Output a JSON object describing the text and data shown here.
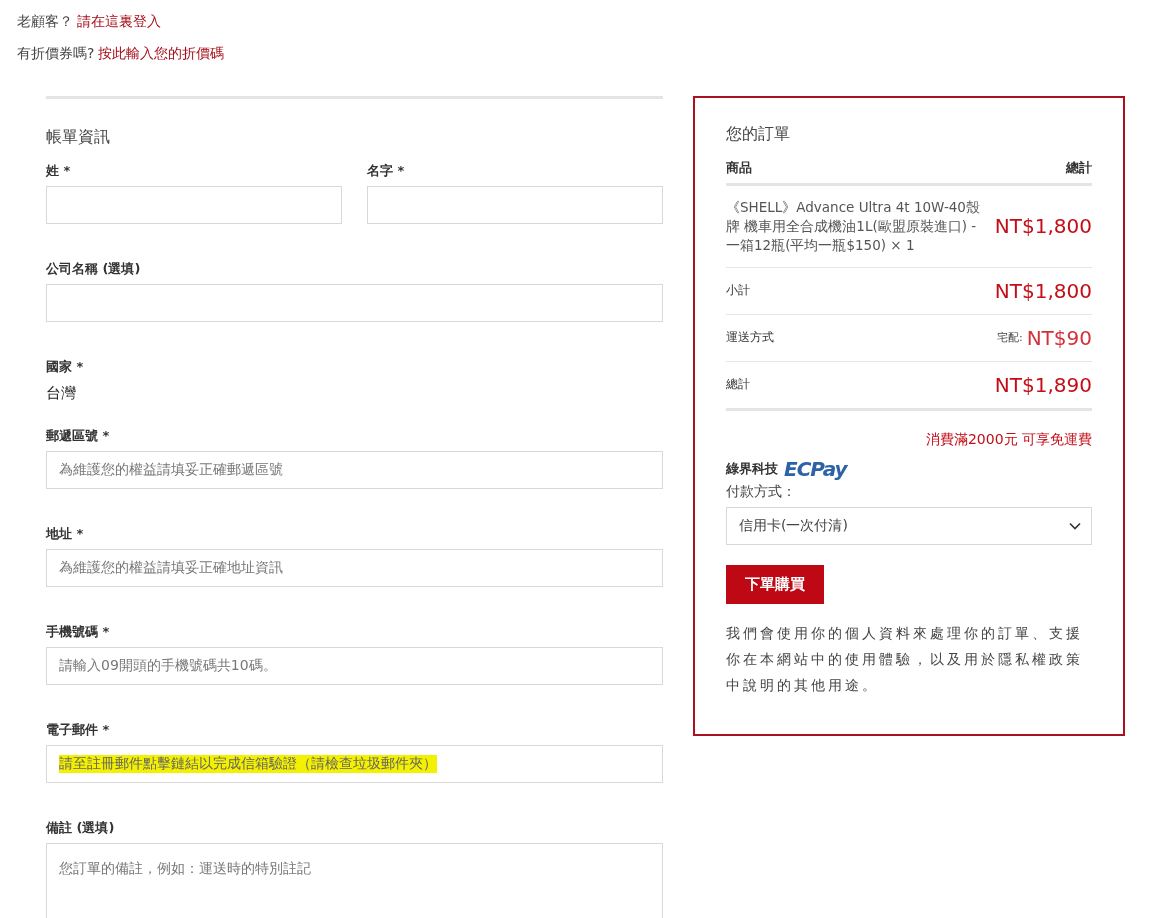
{
  "notices": [
    {
      "text": "老顧客？",
      "link": "請在這裏登入"
    },
    {
      "text": "有折價券嗎?",
      "link": "按此輸入您的折價碼"
    }
  ],
  "billing": {
    "title": "帳單資訊",
    "fields": [
      {
        "kind": "input",
        "label": "姓 *",
        "half": true
      },
      {
        "kind": "input",
        "label": "名字 *",
        "half": true
      },
      {
        "kind": "input",
        "label": "公司名稱 (選填)",
        "half": false
      },
      {
        "kind": "static",
        "label": "國家 *",
        "value": "台灣",
        "half": false
      },
      {
        "kind": "input",
        "label": "郵遞區號 *",
        "placeholder": "為維護您的權益請填妥正確郵遞區號",
        "half": false
      },
      {
        "kind": "input",
        "label": "地址 *",
        "placeholder": "為維護您的權益請填妥正確地址資訊",
        "half": false
      },
      {
        "kind": "input",
        "label": "手機號碼 *",
        "placeholder": "請輸入09開頭的手機號碼共10碼。",
        "half": false
      },
      {
        "kind": "input",
        "label": "電子郵件 *",
        "placeholder": "請至註冊郵件點擊鏈結以完成信箱驗證（請檢查垃圾郵件夾）",
        "highlighted": true,
        "half": false
      },
      {
        "kind": "textarea",
        "label": "備註 (選填)",
        "placeholder": "您訂單的備註，例如：運送時的特別註記",
        "half": false
      }
    ]
  },
  "order": {
    "title": "您的訂單",
    "columns": [
      "商品",
      "總計"
    ],
    "items": [
      {
        "name": "《SHELL》Advance Ultra 4t 10W-40殼牌 機車用全合成機油1L(歐盟原裝進口) - 一箱12瓶(平均一瓶$150)",
        "quantity": "× 1",
        "total": "NT$1,800"
      }
    ],
    "totals": [
      {
        "kind": "subtotal",
        "label": "小計",
        "amount": "NT$1,800"
      },
      {
        "kind": "shipping",
        "label": "運送方式",
        "method": "宅配:",
        "amount": "NT$90"
      },
      {
        "kind": "total",
        "label": "總計",
        "amount": "NT$1,890"
      }
    ],
    "free_shipping_note": "消費滿2000元 可享免運費",
    "payment": {
      "provider": "綠界科技",
      "logo_text": "ECPay",
      "label": "付款方式：",
      "selected_method": "信用卡(一次付清)"
    },
    "place_order": "下單購買",
    "privacy_note": "我們會使用你的個人資料來處理你的訂單、支援你在本網站中的使用體驗，以及用於隱私權政策中說明的其他用途。"
  }
}
